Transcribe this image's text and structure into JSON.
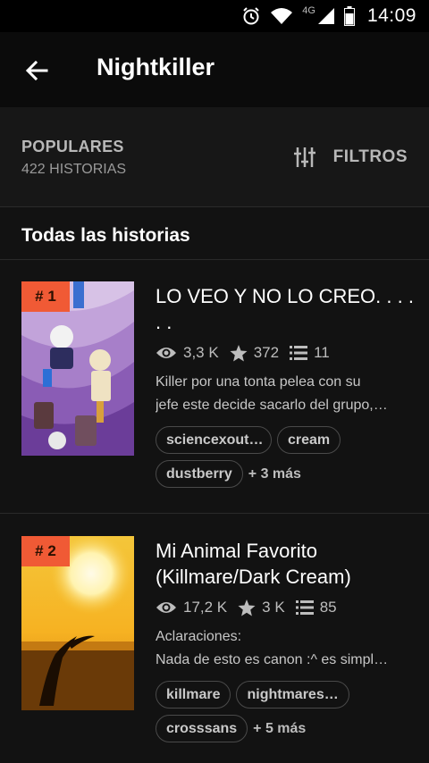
{
  "status_bar": {
    "icons": [
      "alarm-icon",
      "wifi-icon",
      "cell-signal-icon",
      "battery-icon"
    ],
    "network": "4G",
    "time": "14:09"
  },
  "app_bar": {
    "back_icon": "arrow-left-icon",
    "title": "Nightkiller"
  },
  "filter_bar": {
    "sort_label": "POPULARES",
    "count_label": "422 HISTORIAS",
    "filter_icon": "sliders-icon",
    "filter_label": "FILTROS"
  },
  "section": {
    "title": "Todas las historias"
  },
  "stories": [
    {
      "rank": "# 1",
      "title": "LO VEO Y NO LO CREO. . . . . .",
      "reads": "3,3 K",
      "votes": "372",
      "parts": "11",
      "description_lines": [
        "Killer por una tonta pelea con su",
        "jefe este decide sacarlo del grupo,…"
      ],
      "tags": [
        "sciencexout…",
        "cream",
        "dustberry"
      ],
      "more_tags": "+ 3 más"
    },
    {
      "rank": "# 2",
      "title": "Mi Animal Favorito (Killmare/Dark Cream)",
      "reads": "17,2 K",
      "votes": "3 K",
      "parts": "85",
      "description_lines": [
        "Aclaraciones:",
        "Nada de esto es canon :^ es simpl…"
      ],
      "tags": [
        "killmare",
        "nightmares…",
        "crosssans"
      ],
      "more_tags": "+ 5 más"
    }
  ],
  "colors": {
    "background": "#121212",
    "app_bar": "#0b0b0b",
    "rank_badge": "#f05a35",
    "secondary_text": "#bdbdbd"
  }
}
